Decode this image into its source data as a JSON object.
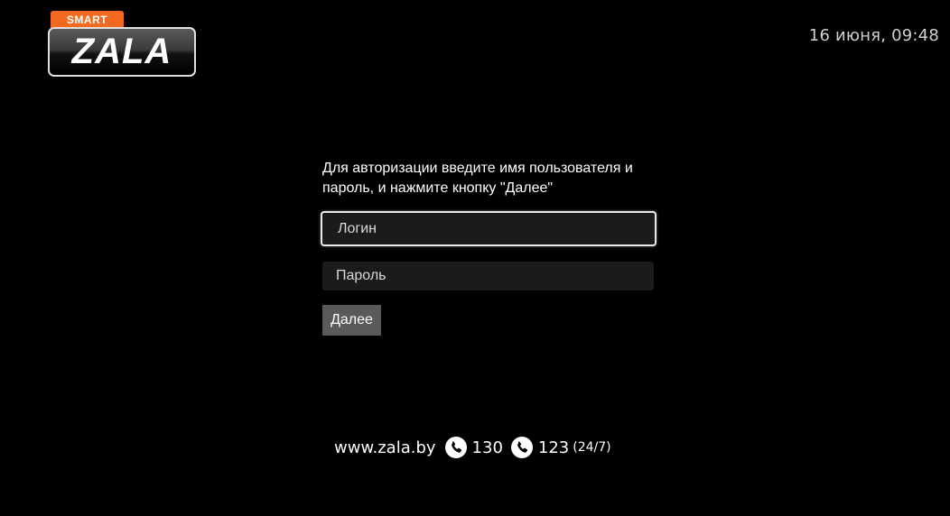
{
  "logo": {
    "badge": "SMART",
    "name": "ZALA"
  },
  "header": {
    "datetime": "16 июня, 09:48"
  },
  "login_form": {
    "instructions": "Для авторизации введите имя пользователя и пароль, и нажмите кнопку \"Далее\"",
    "login_placeholder": "Логин",
    "password_placeholder": "Пароль",
    "next_label": "Далее"
  },
  "footer": {
    "website": "www.zala.by",
    "phone_1": "130",
    "phone_2": "123",
    "hours": "(24/7)"
  },
  "colors": {
    "background": "#000000",
    "brand_orange": "#f26a1f",
    "field_background": "#1b1b1b",
    "button_background": "#5a5a5a"
  },
  "icons": [
    "phone-icon"
  ]
}
